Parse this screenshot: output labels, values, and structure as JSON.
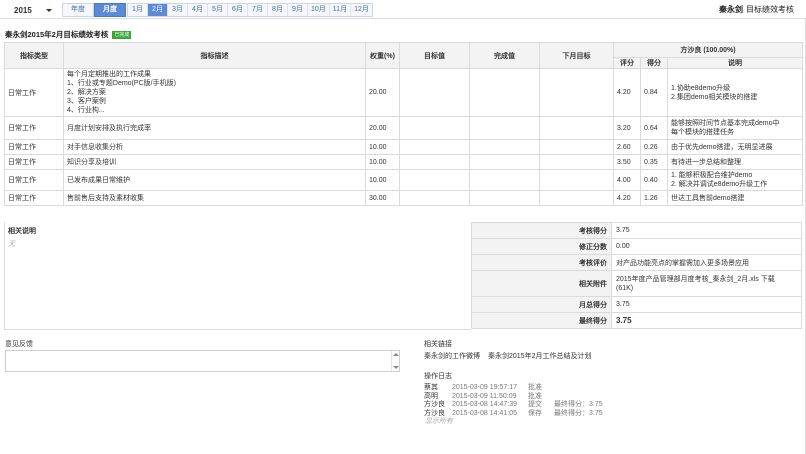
{
  "toolbar": {
    "year": "2015",
    "annual_label": "年度",
    "monthly_label": "月度",
    "months": [
      "1月",
      "2月",
      "3月",
      "4月",
      "5月",
      "6月",
      "7月",
      "8月",
      "9月",
      "10月",
      "11月",
      "12月"
    ],
    "active_month_index": 1,
    "app_user": "秦永剑",
    "app_title": "目标绩效考核"
  },
  "header": {
    "title": "秦永剑2015年2月目标绩效考核",
    "badge": "已完成"
  },
  "table": {
    "headers": {
      "type": "指标类型",
      "desc": "指标描述",
      "weight": "权重(%)",
      "target": "目标值",
      "done": "完成值",
      "next": "下月目标",
      "reviewer": "方沙良 (100.00%)",
      "rating": "评分",
      "score": "得分",
      "note": "说明"
    },
    "rows": [
      {
        "type": "日常工作",
        "desc": [
          "每个月定期推出的工作成果",
          "1、行业或专题Demo(PC版/手机版)",
          "2、解决方案",
          "3、客户案例",
          "4、行业构..."
        ],
        "weight": "20.00",
        "rating": "4.20",
        "score": "0.84",
        "note": [
          "1.协助e8demo升级",
          "2.集团demo相关模块的搭建"
        ]
      },
      {
        "type": "日常工作",
        "desc": [
          "月度计划安排及执行完成率"
        ],
        "weight": "20.00",
        "rating": "3.20",
        "score": "0.64",
        "note": [
          "能够按照时间节点基本完成demo中",
          "每个模块的搭建任务"
        ]
      },
      {
        "type": "日常工作",
        "desc": [
          "对手信息收集分析"
        ],
        "weight": "10.00",
        "rating": "2.60",
        "score": "0.26",
        "note": [
          "由于优先demo搭建，无明显进展"
        ]
      },
      {
        "type": "日常工作",
        "desc": [
          "知识分享及培训"
        ],
        "weight": "10.00",
        "rating": "3.50",
        "score": "0.35",
        "note": [
          "有待进一步总结和整理"
        ]
      },
      {
        "type": "日常工作",
        "desc": [
          "已发布成果日常维护"
        ],
        "weight": "10.00",
        "rating": "4.00",
        "score": "0.40",
        "note": [
          "1. 能够积极配合维护demo",
          "2. 解决并调试e8demo升级工作"
        ]
      },
      {
        "type": "日常工作",
        "desc": [
          "售前售后支持及素材收集"
        ],
        "weight": "30.00",
        "rating": "4.20",
        "score": "1.26",
        "note": [
          "世达工具售前demo搭建"
        ]
      }
    ]
  },
  "related_note": {
    "label": "相关说明",
    "empty": "无"
  },
  "summary": {
    "review_score_label": "考核得分",
    "review_score": "3.75",
    "correction_label": "修正分数",
    "correction": "0.00",
    "comment_label": "考核评价",
    "comment": "对产品功能亮点的掌握需加入更多场景应用",
    "attachment_label": "相关附件",
    "attachment_line1": "2015年度产品管理部月度考核_秦永剑_2月.xls  下载",
    "attachment_line2": "(61K)",
    "month_total_label": "月总得分",
    "month_total": "3.75",
    "final_label": "最终得分",
    "final": "3.75"
  },
  "feedback": {
    "label": "意见反馈",
    "value": ""
  },
  "links": {
    "label": "相关链接",
    "items": [
      "秦永剑的工作微博",
      "秦永剑2015年2月工作总结及计划"
    ]
  },
  "log": {
    "label": "操作日志",
    "entries": [
      {
        "user": "蔡其",
        "time": "2015-03-09  19:57:17",
        "action": "批准",
        "score": ""
      },
      {
        "user": "高明",
        "time": "2015-03-09  11:50:09",
        "action": "批准",
        "score": ""
      },
      {
        "user": "方沙良",
        "time": "2015-03-08  14:47:39",
        "action": "提交",
        "score": "最终得分：3.75"
      },
      {
        "user": "方沙良",
        "time": "2015-03-08  14:41:05",
        "action": "保存",
        "score": "最终得分：3.75"
      }
    ],
    "show_all": "显示所有"
  },
  "colors": {
    "accent": "#5b8ad6",
    "badge": "#3aa63a",
    "border": "#dadada"
  }
}
